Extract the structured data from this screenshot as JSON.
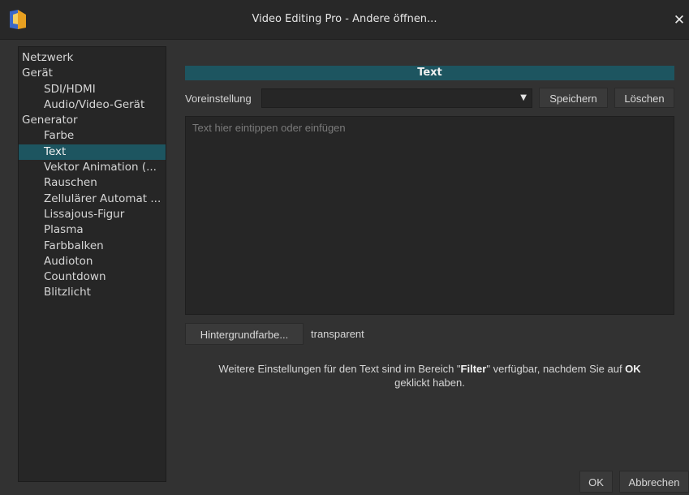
{
  "window": {
    "title": "Video Editing Pro - Andere öffnen...",
    "close_glyph": "✕",
    "logo_icon": "app-logo"
  },
  "sidebar": {
    "items": [
      {
        "label": "Netzwerk",
        "level": 0
      },
      {
        "label": "Gerät",
        "level": 0
      },
      {
        "label": "SDI/HDMI",
        "level": 1
      },
      {
        "label": "Audio/Video-Gerät",
        "level": 1
      },
      {
        "label": "Generator",
        "level": 0
      },
      {
        "label": "Farbe",
        "level": 1
      },
      {
        "label": "Text",
        "level": 1,
        "selected": true
      },
      {
        "label": "Vektor Animation (...",
        "level": 1
      },
      {
        "label": "Rauschen",
        "level": 1
      },
      {
        "label": "Zellulärer Automat ...",
        "level": 1
      },
      {
        "label": "Lissajous-Figur",
        "level": 1
      },
      {
        "label": "Plasma",
        "level": 1
      },
      {
        "label": "Farbbalken",
        "level": 1
      },
      {
        "label": "Audioton",
        "level": 1
      },
      {
        "label": "Countdown",
        "level": 1
      },
      {
        "label": "Blitzlicht",
        "level": 1
      }
    ]
  },
  "panel": {
    "header": "Text",
    "preset_label": "Voreinstellung",
    "preset_value": "",
    "save_label": "Speichern",
    "delete_label": "Löschen",
    "text_placeholder": "Text hier eintippen oder einfügen",
    "bg_color_button": "Hintergrundfarbe...",
    "bg_color_value": "transparent",
    "info_part1": "Weitere Einstellungen für den Text sind im Bereich \"",
    "info_bold1": "Filter",
    "info_part2": "\" verfügbar, nachdem Sie auf ",
    "info_bold2": "OK",
    "info_part3": "geklickt haben."
  },
  "footer": {
    "ok_label": "OK",
    "cancel_label": "Abbrechen"
  },
  "colors": {
    "accent": "#1d5560",
    "background": "#323232",
    "field": "#262626"
  }
}
